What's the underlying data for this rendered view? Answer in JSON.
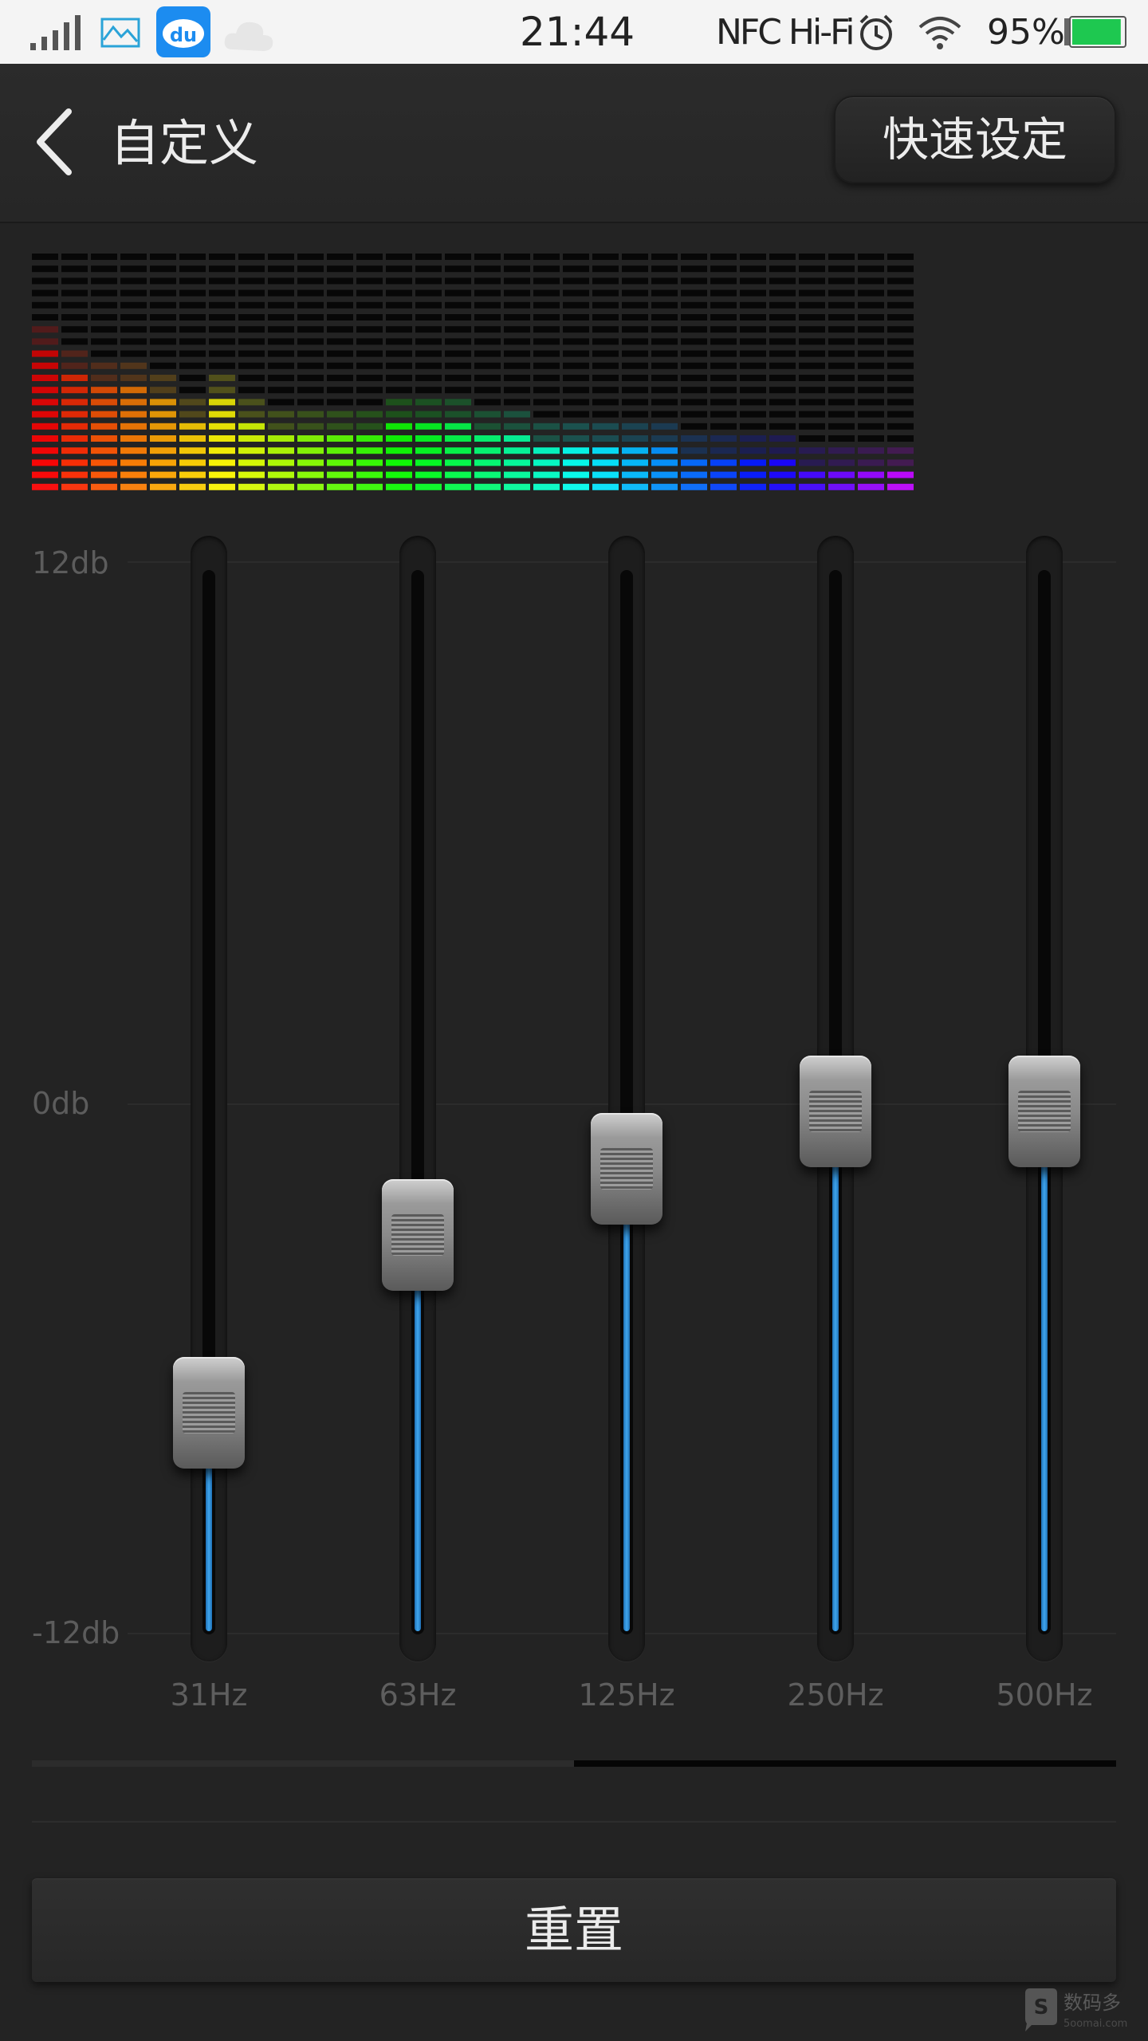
{
  "status_bar": {
    "time": "21:44",
    "nfc_hifi": "NFC Hi-Fi",
    "battery": "95%",
    "icons": [
      "signal-icon",
      "gallery-icon",
      "baidu-du-icon",
      "cloud-icon",
      "alarm-icon",
      "wifi-icon",
      "battery-icon"
    ],
    "battery_level": 0.95,
    "battery_color": "#1ec850"
  },
  "header": {
    "title": "自定义",
    "quick_set_label": "快速设定",
    "back_icon": "chevron-left-icon"
  },
  "equalizer": {
    "db_labels": [
      "12db",
      "0db",
      "-12db"
    ],
    "db_range": [
      -12,
      12
    ],
    "accent_color": "#3fa6ee",
    "bands": [
      {
        "label": "31Hz",
        "value": -7
      },
      {
        "label": "63Hz",
        "value": -3
      },
      {
        "label": "125Hz",
        "value": -1.5
      },
      {
        "label": "250Hz",
        "value": -0.2
      },
      {
        "label": "500Hz",
        "value": -0.2
      }
    ]
  },
  "spectrum_levels": [
    12,
    10,
    9,
    9,
    8,
    6,
    8,
    6,
    5,
    5,
    5,
    5,
    6,
    6,
    6,
    5,
    5,
    4,
    4,
    4,
    4,
    4,
    3,
    3,
    3,
    3,
    2,
    2,
    2,
    2
  ],
  "footer": {
    "reset_label": "重置",
    "page_indicator_active": 2,
    "page_indicator_count": 2
  },
  "watermark": {
    "text": "数码多",
    "subtext": "5oomai.com"
  }
}
